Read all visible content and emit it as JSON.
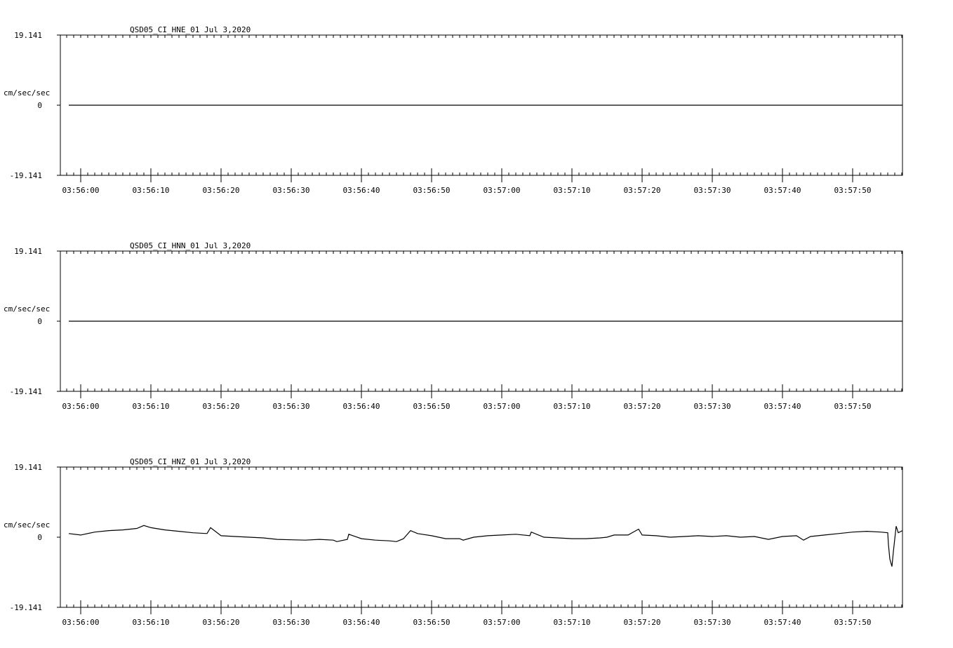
{
  "chart_data": [
    {
      "type": "line",
      "title": "QSD05_CI_HNE_01  Jul 3,2020",
      "ylabel": "cm/sec/sec",
      "ylim": [
        -19.141,
        19.141
      ],
      "y_tick_labels": [
        "19.141",
        "0",
        "-19.141"
      ],
      "x_tick_labels": [
        "03:56:00",
        "03:56:10",
        "03:56:20",
        "03:56:30",
        "03:56:40",
        "03:56:50",
        "03:57:00",
        "03:57:10",
        "03:57:20",
        "03:57:30",
        "03:57:40",
        "03:57:50"
      ],
      "x_range_seconds": [
        -2.9,
        117.1
      ],
      "series": [
        {
          "x": [
            -1.7,
            117.1
          ],
          "values": [
            0.0,
            0.0
          ]
        }
      ],
      "grid": false
    },
    {
      "type": "line",
      "title": "QSD05_CI_HNN_01  Jul 3,2020",
      "ylabel": "cm/sec/sec",
      "ylim": [
        -19.141,
        19.141
      ],
      "y_tick_labels": [
        "19.141",
        "0",
        "-19.141"
      ],
      "x_tick_labels": [
        "03:56:00",
        "03:56:10",
        "03:56:20",
        "03:56:30",
        "03:56:40",
        "03:56:50",
        "03:57:00",
        "03:57:10",
        "03:57:20",
        "03:57:30",
        "03:57:40",
        "03:57:50"
      ],
      "x_range_seconds": [
        -2.9,
        117.1
      ],
      "series": [
        {
          "x": [
            -1.7,
            117.1
          ],
          "values": [
            0.0,
            0.0
          ]
        }
      ],
      "grid": false
    },
    {
      "type": "line",
      "title": "QSD05_CI_HNZ_01  Jul 3,2020",
      "ylabel": "cm/sec/sec",
      "ylim": [
        -19.141,
        19.141
      ],
      "y_tick_labels": [
        "19.141",
        "0",
        "-19.141"
      ],
      "x_tick_labels": [
        "03:56:00",
        "03:56:10",
        "03:56:20",
        "03:56:30",
        "03:56:40",
        "03:56:50",
        "03:57:00",
        "03:57:10",
        "03:57:20",
        "03:57:30",
        "03:57:40",
        "03:57:50"
      ],
      "x_range_seconds": [
        -2.9,
        117.1
      ],
      "series": [
        {
          "x": [
            -1.7,
            0,
            2,
            4,
            6,
            8,
            9,
            10,
            12,
            14,
            16,
            18,
            18.5,
            20,
            22,
            24,
            26,
            28,
            30,
            32,
            34,
            36,
            36.5,
            38,
            38.2,
            40,
            42,
            44,
            45,
            46,
            47,
            48,
            50,
            52,
            54,
            54.5,
            56,
            58,
            60,
            62,
            64,
            64.2,
            66,
            68,
            70,
            72,
            74,
            75,
            76,
            78,
            79.5,
            80,
            82,
            84,
            86,
            88,
            90,
            92,
            94,
            96,
            98,
            100,
            102,
            103,
            104,
            106,
            108,
            110,
            112,
            114,
            115,
            115.1,
            115.3,
            115.6,
            115.8,
            116.2,
            116.5,
            117.1
          ],
          "values": [
            1.0,
            0.6,
            1.4,
            1.8,
            2.0,
            2.4,
            3.2,
            2.6,
            2.0,
            1.6,
            1.2,
            1.0,
            2.6,
            0.4,
            0.2,
            0.0,
            -0.2,
            -0.6,
            -0.7,
            -0.8,
            -0.6,
            -0.8,
            -1.2,
            -0.6,
            0.8,
            -0.4,
            -0.8,
            -1.0,
            -1.2,
            -0.4,
            1.8,
            1.0,
            0.4,
            -0.4,
            -0.4,
            -0.8,
            0.0,
            0.4,
            0.6,
            0.8,
            0.4,
            1.4,
            0.0,
            -0.2,
            -0.4,
            -0.4,
            -0.2,
            0.0,
            0.6,
            0.6,
            2.2,
            0.6,
            0.4,
            0.0,
            0.2,
            0.4,
            0.2,
            0.4,
            0.0,
            0.2,
            -0.6,
            0.2,
            0.4,
            -0.8,
            0.2,
            0.6,
            1.0,
            1.4,
            1.6,
            1.4,
            1.2,
            -2.0,
            -6.0,
            -8.0,
            -4.0,
            3.0,
            1.2,
            1.8
          ]
        }
      ],
      "grid": false
    }
  ]
}
